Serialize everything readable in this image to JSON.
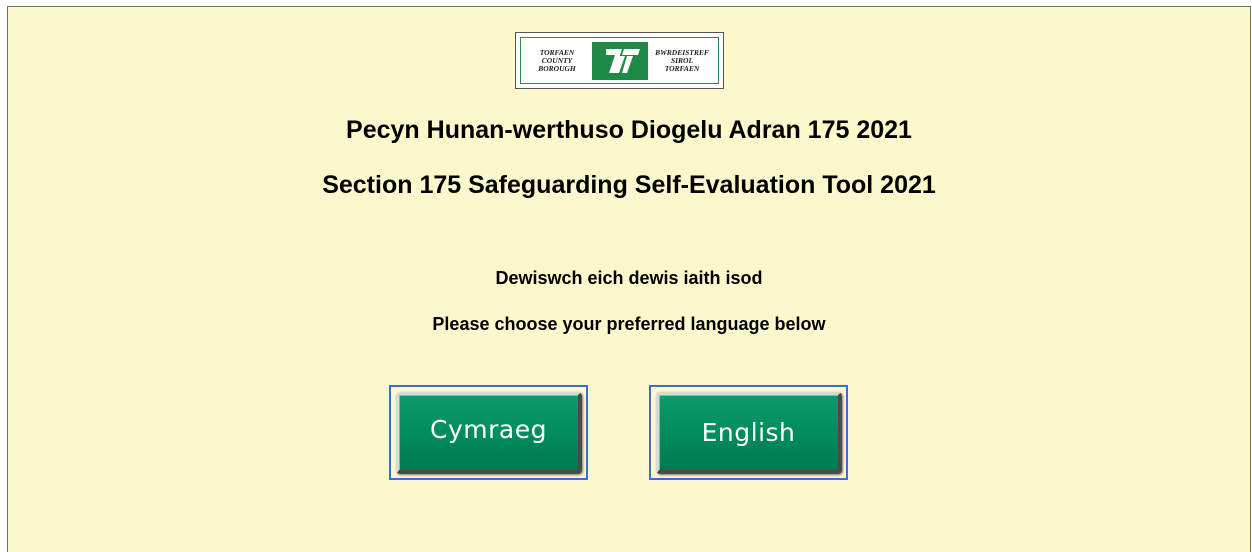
{
  "logo": {
    "left_lines": [
      "TORFAEN",
      "COUNTY",
      "BOROUGH"
    ],
    "right_lines": [
      "BWRDEISTREF",
      "SIROL",
      "TORFAEN"
    ],
    "brand_color": "#1e8a48"
  },
  "titles": {
    "welsh": "Pecyn Hunan-werthuso Diogelu Adran 175 2021",
    "english": "Section 175 Safeguarding Self-Evaluation Tool 2021"
  },
  "prompts": {
    "welsh": "Dewiswch eich dewis iaith isod",
    "english": "Please choose your preferred language below"
  },
  "buttons": {
    "welsh_label": "Cymraeg",
    "english_label": "English",
    "color": "#008b5b"
  },
  "colors": {
    "background": "#fbf8cc",
    "focus_frame": "#3a6ed0"
  }
}
